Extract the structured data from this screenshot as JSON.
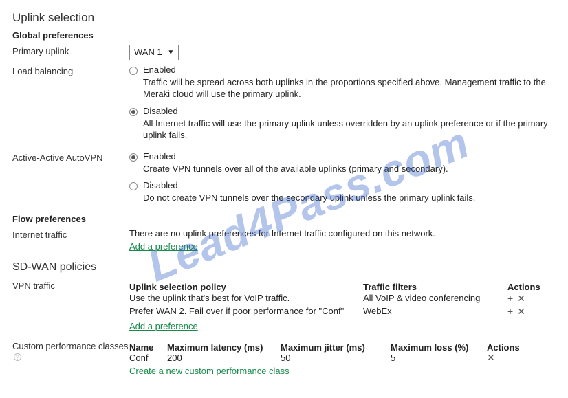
{
  "watermark": "Lead4Pass.com",
  "section": {
    "title": "Uplink selection",
    "globalPrefs": {
      "heading": "Global preferences",
      "primaryUplink": {
        "label": "Primary uplink",
        "value": "WAN 1"
      },
      "loadBalancing": {
        "label": "Load balancing",
        "options": [
          {
            "label": "Enabled",
            "selected": false,
            "desc": "Traffic will be spread across both uplinks in the proportions specified above. Management traffic to the Meraki cloud will use the primary uplink."
          },
          {
            "label": "Disabled",
            "selected": true,
            "desc": "All Internet traffic will use the primary uplink unless overridden by an uplink preference or if the primary uplink fails."
          }
        ]
      },
      "activeActive": {
        "label": "Active-Active AutoVPN",
        "options": [
          {
            "label": "Enabled",
            "selected": true,
            "desc": "Create VPN tunnels over all of the available uplinks (primary and secondary)."
          },
          {
            "label": "Disabled",
            "selected": false,
            "desc": "Do not create VPN tunnels over the secondary uplink unless the primary uplink fails."
          }
        ]
      }
    },
    "flowPrefs": {
      "heading": "Flow preferences",
      "internetTraffic": {
        "label": "Internet traffic",
        "message": "There are no uplink preferences for Internet traffic configured on this network.",
        "addLink": "Add a preference"
      }
    },
    "sdwan": {
      "heading": "SD-WAN policies",
      "vpnTraffic": {
        "label": "VPN traffic",
        "headers": {
          "policy": "Uplink selection policy",
          "filters": "Traffic filters",
          "actions": "Actions"
        },
        "rows": [
          {
            "policy": "Use the uplink that's best for VoIP traffic.",
            "filter": "All VoIP & video conferencing"
          },
          {
            "policy": "Prefer WAN 2. Fail over if poor performance for \"Conf\"",
            "filter": "WebEx"
          }
        ],
        "addLink": "Add a preference"
      },
      "customPerf": {
        "label": "Custom performance classes",
        "headers": {
          "name": "Name",
          "latency": "Maximum latency (ms)",
          "jitter": "Maximum jitter (ms)",
          "loss": "Maximum loss (%)",
          "actions": "Actions"
        },
        "rows": [
          {
            "name": "Conf",
            "latency": "200",
            "jitter": "50",
            "loss": "5"
          }
        ],
        "addLink": "Create a new custom performance class"
      }
    }
  }
}
